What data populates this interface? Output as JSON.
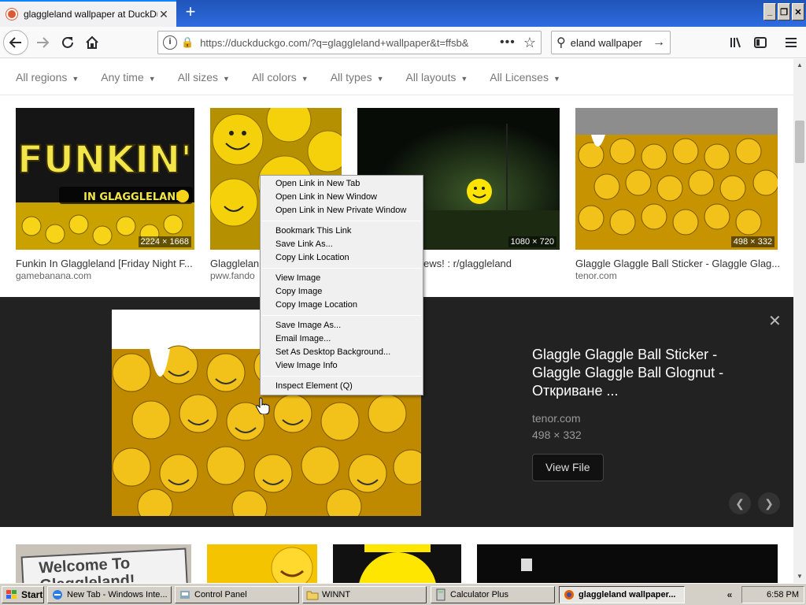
{
  "browser": {
    "tab_title": "glaggleland wallpaper at DuckDuckGo",
    "tab_close": "✕",
    "new_tab": "+",
    "url": "https://duckduckgo.com/?q=glaggleland+wallpaper&t=ffsb&",
    "search_text": "eland wallpaper",
    "window_controls": [
      "_",
      "❐",
      "✕"
    ]
  },
  "filters": [
    {
      "label": "All regions"
    },
    {
      "label": "Any time"
    },
    {
      "label": "All sizes"
    },
    {
      "label": "All colors"
    },
    {
      "label": "All types"
    },
    {
      "label": "All layouts"
    },
    {
      "label": "All Licenses"
    }
  ],
  "results": [
    {
      "title": "Funkin In Glaggleland [Friday Night F...",
      "source": "gamebanana.com",
      "dims": "2224 × 1668",
      "thumb_text": "FUNKIN'",
      "thumb_subtext": "IN GLAGGLELAND"
    },
    {
      "title": "Glagglelan",
      "source": "pww.fando",
      "dims": ""
    },
    {
      "title": "ews! : r/glaggleland",
      "source": "",
      "dims": "1080 × 720"
    },
    {
      "title": "Glaggle Glaggle Ball Sticker - Glaggle Glag...",
      "source": "tenor.com",
      "dims": "498 × 332"
    }
  ],
  "detail": {
    "title": "Glaggle Glaggle Ball Sticker - Glaggle Glaggle Ball Glognut - Откриване ...",
    "source": "tenor.com",
    "dims": "498 × 332",
    "view_button": "View File",
    "close": "✕"
  },
  "bottom_row": [
    {
      "text": "Welcome To Glaggleland!"
    }
  ],
  "context_menu": {
    "group1": [
      "Open Link in New Tab",
      "Open Link in New Window",
      "Open Link in New Private Window"
    ],
    "group2": [
      "Bookmark This Link",
      "Save Link As...",
      "Copy Link Location"
    ],
    "group3": [
      "View Image",
      "Copy Image",
      "Copy Image Location"
    ],
    "group4": [
      "Save Image As...",
      "Email Image...",
      "Set As Desktop Background...",
      "View Image Info"
    ],
    "group5": [
      "Inspect Element (Q)"
    ]
  },
  "taskbar": {
    "start": "Start",
    "items": [
      "New Tab - Windows Inte...",
      "Control Panel",
      "WINNT",
      "Calculator Plus",
      "glaggleland wallpaper..."
    ],
    "tray_arrow": "«",
    "clock": "6:58 PM"
  }
}
